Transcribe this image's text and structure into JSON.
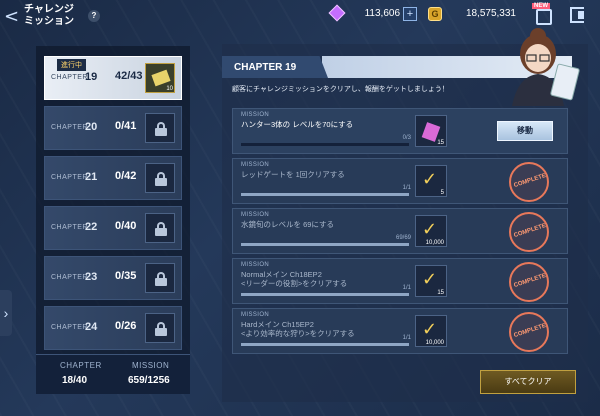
{
  "header": {
    "title_line1": "チャレンジ",
    "title_line2": "ミッション",
    "help_label": "?",
    "gems": "113,606",
    "coins": "18,575,331",
    "new_badge": "NEW"
  },
  "sidebar": {
    "chapters": [
      {
        "label": "CHAPTER",
        "number": "19",
        "progress": "42/43",
        "status": "進行中",
        "qty": "10",
        "locked": false
      },
      {
        "label": "CHAPTER",
        "number": "20",
        "progress": "0/41",
        "locked": true
      },
      {
        "label": "CHAPTER",
        "number": "21",
        "progress": "0/42",
        "locked": true
      },
      {
        "label": "CHAPTER",
        "number": "22",
        "progress": "0/40",
        "locked": true
      },
      {
        "label": "CHAPTER",
        "number": "23",
        "progress": "0/35",
        "locked": true
      },
      {
        "label": "CHAPTER",
        "number": "24",
        "progress": "0/26",
        "locked": true
      }
    ],
    "summary": {
      "chapter_label": "CHAPTER",
      "chapter_value": "18/40",
      "mission_label": "MISSION",
      "mission_value": "659/1256"
    }
  },
  "main": {
    "chapter_title": "CHAPTER 19",
    "description": "顧客にチャレンジミッションをクリアし、報酬をゲットしましょう！",
    "missions": [
      {
        "label": "MISSION",
        "text": "ハンター3体の レベルを70にする",
        "progress": "0/3",
        "fill": 0.0,
        "reward": "ticket",
        "qty": "15",
        "action": "移動",
        "done": false
      },
      {
        "label": "MISSION",
        "text": "レッドゲートを 1回クリアする",
        "progress": "1/1",
        "fill": 1.0,
        "reward": "check",
        "qty": "5",
        "done": true,
        "stamp": "COMPLETE"
      },
      {
        "label": "MISSION",
        "text": "水鏡旬のレベルを 69にする",
        "progress": "69/69",
        "fill": 1.0,
        "reward": "coin",
        "qty": "10,000",
        "done": true,
        "stamp": "COMPLETE"
      },
      {
        "label": "MISSION",
        "text": "Normalメイン Ch18EP2\n<リーダーの役割>をクリアする",
        "progress": "1/1",
        "fill": 1.0,
        "reward": "ticket",
        "qty": "15",
        "done": true,
        "stamp": "COMPLETE"
      },
      {
        "label": "MISSION",
        "text": "Hardメイン Ch15EP2\n<より効率的な狩り>をクリアする",
        "progress": "1/1",
        "fill": 1.0,
        "reward": "coin",
        "qty": "10,000",
        "done": true,
        "stamp": "COMPLETE"
      }
    ],
    "clear_all": "すべてクリア"
  }
}
